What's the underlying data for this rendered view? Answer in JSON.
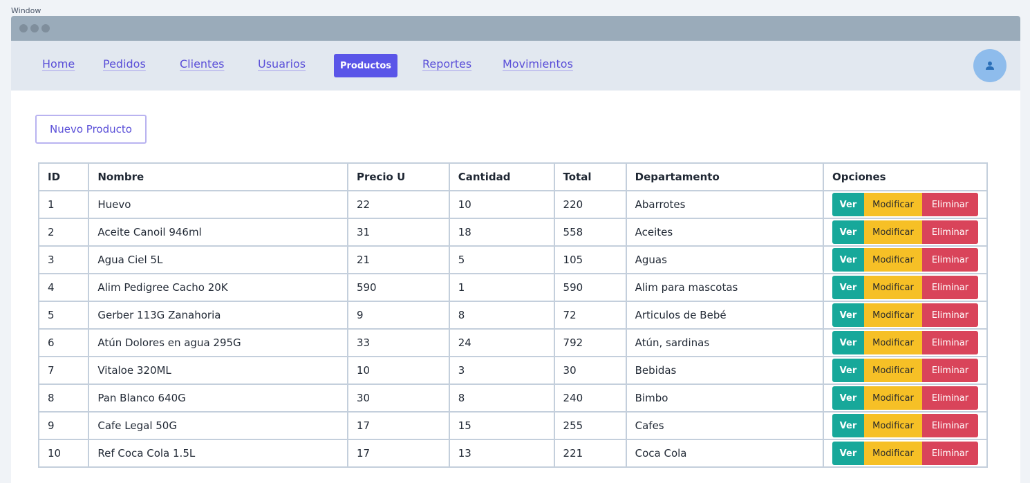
{
  "window": {
    "caption": "Window"
  },
  "nav": {
    "links": [
      {
        "label": "Home"
      },
      {
        "label": "Pedidos"
      },
      {
        "label": "Clientes"
      },
      {
        "label": "Usuarios"
      },
      {
        "label": "Productos",
        "active": true
      },
      {
        "label": "Reportes"
      },
      {
        "label": "Movimientos"
      }
    ],
    "avatar_icon": "user-icon"
  },
  "actions": {
    "new_product_label": "Nuevo Producto"
  },
  "table": {
    "headers": [
      "ID",
      "Nombre",
      "Precio U",
      "Cantidad",
      "Total",
      "Departamento",
      "Opciones"
    ],
    "option_labels": {
      "view": "Ver",
      "edit": "Modificar",
      "delete": "Eliminar"
    },
    "rows": [
      {
        "id": "1",
        "nombre": "Huevo",
        "precio": "22",
        "cantidad": "10",
        "total": "220",
        "departamento": "Abarrotes"
      },
      {
        "id": "2",
        "nombre": "Aceite Canoil 946ml",
        "precio": "31",
        "cantidad": "18",
        "total": "558",
        "departamento": "Aceites"
      },
      {
        "id": "3",
        "nombre": "Agua Ciel 5L",
        "precio": "21",
        "cantidad": "5",
        "total": "105",
        "departamento": "Aguas"
      },
      {
        "id": "4",
        "nombre": "Alim Pedigree Cacho 20K",
        "precio": "590",
        "cantidad": "1",
        "total": "590",
        "departamento": "Alim para mascotas"
      },
      {
        "id": "5",
        "nombre": "Gerber 113G Zanahoria",
        "precio": "9",
        "cantidad": "8",
        "total": "72",
        "departamento": "Articulos de Bebé"
      },
      {
        "id": "6",
        "nombre": "Atún Dolores en agua 295G",
        "precio": "33",
        "cantidad": "24",
        "total": "792",
        "departamento": "Atún, sardinas"
      },
      {
        "id": "7",
        "nombre": "Vitaloe 320ML",
        "precio": "10",
        "cantidad": "3",
        "total": "30",
        "departamento": "Bebidas"
      },
      {
        "id": "8",
        "nombre": "Pan Blanco 640G",
        "precio": "30",
        "cantidad": "8",
        "total": "240",
        "departamento": "Bimbo"
      },
      {
        "id": "9",
        "nombre": "Cafe Legal 50G",
        "precio": "17",
        "cantidad": "15",
        "total": "255",
        "departamento": "Cafes"
      },
      {
        "id": "10",
        "nombre": "Ref Coca Cola 1.5L",
        "precio": "17",
        "cantidad": "13",
        "total": "221",
        "departamento": "Coca Cola"
      }
    ]
  },
  "colors": {
    "accent": "#5a55e8",
    "ver": "#17a89a",
    "modificar": "#f6c026",
    "eliminar": "#d9445a",
    "navbar_bg": "#e2e8f0",
    "titlebar_bg": "#9aabba"
  }
}
